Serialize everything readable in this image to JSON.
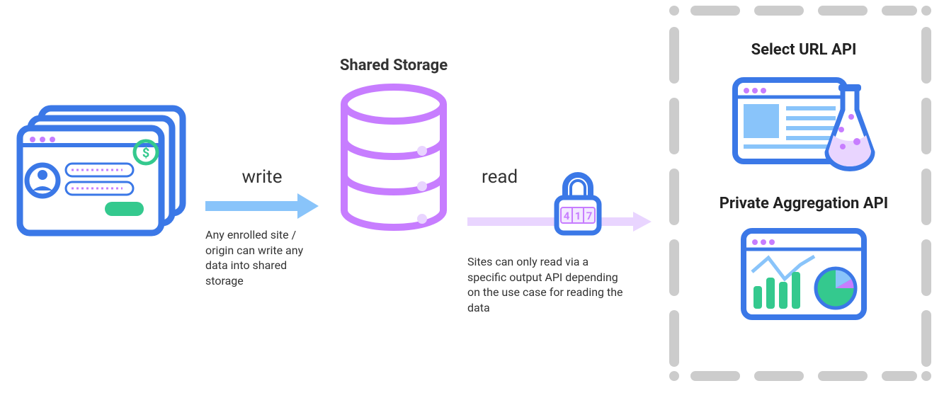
{
  "nodes": {
    "storage_title": "Shared Storage",
    "select_url_title": "Select URL API",
    "private_agg_title": "Private Aggregation API"
  },
  "arrows": {
    "write": {
      "label": "write",
      "desc": "Any enrolled site / origin can write any data into shared storage"
    },
    "read": {
      "label": "read",
      "desc": "Sites can only read via a specific output API depending on the use case for reading the data",
      "lock_digits": "417"
    }
  },
  "colors": {
    "blue": "#3b78e7",
    "purple": "#c77dff",
    "lightblue": "#89c4fa",
    "lilac": "#e9d5ff",
    "green": "#34c98e",
    "gray": "#cccccc"
  }
}
